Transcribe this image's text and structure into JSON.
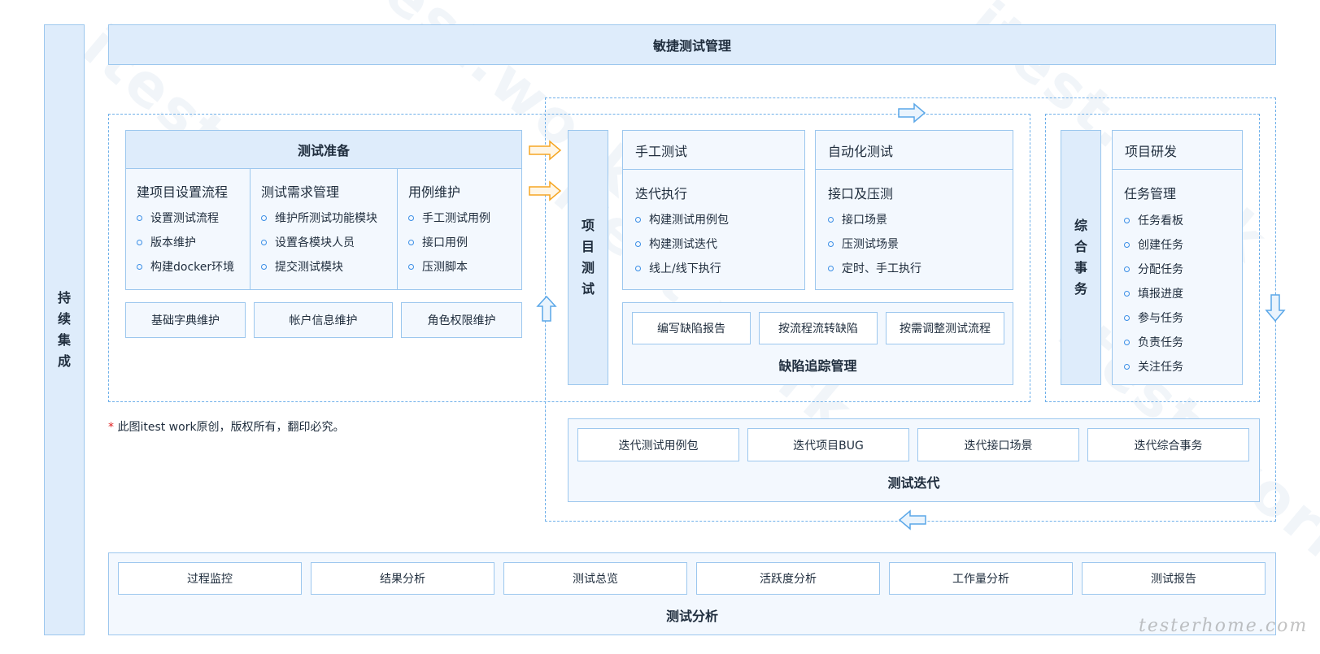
{
  "left_bar": {
    "chars": [
      "持",
      "续",
      "集",
      "成"
    ]
  },
  "top_bar": {
    "title": "敏捷测试管理"
  },
  "prep": {
    "title": "测试准备",
    "columns": [
      {
        "heading": "建项目设置流程",
        "items": [
          "设置测试流程",
          "版本维护",
          "构建docker环境"
        ]
      },
      {
        "heading": "测试需求管理",
        "items": [
          "维护所测试功能模块",
          "设置各模块人员",
          "提交测试模块"
        ]
      },
      {
        "heading": "用例维护",
        "items": [
          "手工测试用例",
          "接口用例",
          "压测脚本"
        ]
      }
    ],
    "bottom": [
      "基础字典维护",
      "帐户信息维护",
      "角色权限维护"
    ]
  },
  "project_test": {
    "chars": [
      "项",
      "目",
      "测",
      "试"
    ]
  },
  "manual": {
    "title": "手工测试",
    "heading": "迭代执行",
    "items": [
      "构建测试用例包",
      "构建测试迭代",
      "线上/线下执行"
    ]
  },
  "auto": {
    "title": "自动化测试",
    "heading": "接口及压测",
    "items": [
      "接口场景",
      "压测试场景",
      "定时、手工执行"
    ]
  },
  "defect": {
    "items": [
      "编写缺陷报告",
      "按流程流转缺陷",
      "按需调整测试流程"
    ],
    "title": "缺陷追踪管理"
  },
  "affairs": {
    "chars": [
      "综",
      "合",
      "事",
      "务"
    ]
  },
  "dev": {
    "title": "项目研发",
    "heading": "任务管理",
    "items": [
      "任务看板",
      "创建任务",
      "分配任务",
      "填报进度",
      "参与任务",
      "负责任务",
      "关注任务"
    ]
  },
  "note": {
    "star": "*",
    "text": "此图itest work原创，版权所有，翻印必究。"
  },
  "iteration": {
    "items": [
      "迭代测试用例包",
      "迭代项目BUG",
      "迭代接口场景",
      "迭代综合事务"
    ],
    "title": "测试迭代"
  },
  "analysis": {
    "items": [
      "过程监控",
      "结果分析",
      "测试总览",
      "活跃度分析",
      "工作量分析",
      "测试报告"
    ],
    "title": "测试分析"
  },
  "watermark_text": "itest.work",
  "signature": "testerhome.com",
  "colors": {
    "border": "#9cc7ee",
    "fill_light": "#f3f8fe",
    "fill_blue": "#deecfb",
    "dash": "#6fb0ea",
    "arrow_orange": "#f5a623",
    "arrow_blue": "#5aa7e8",
    "star": "#e02020"
  }
}
